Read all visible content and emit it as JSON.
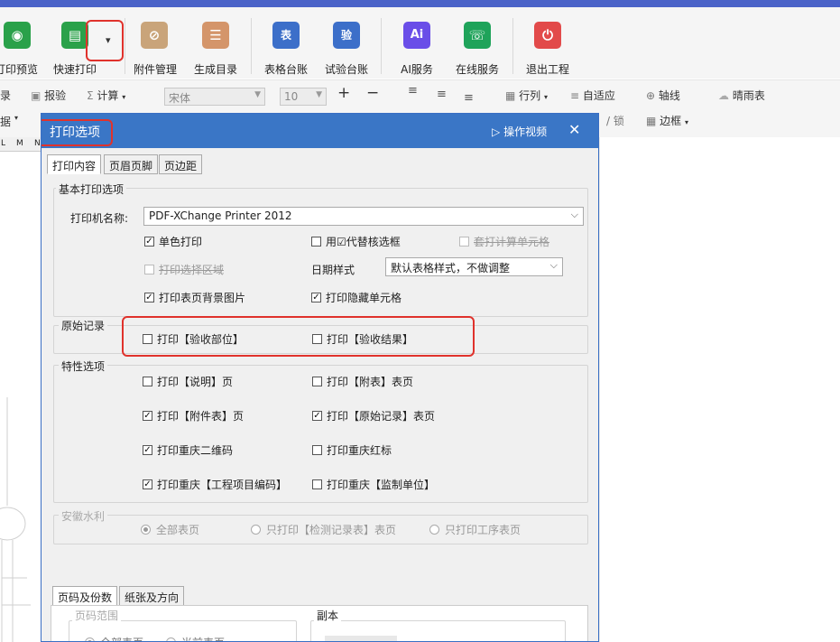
{
  "ribbon": {
    "items": [
      {
        "label": "打印预览",
        "icon": "eye-icon",
        "color": "#2aa14a",
        "glyph": "◉"
      },
      {
        "label": "快速打印",
        "icon": "printer-icon",
        "color": "#2aa14a",
        "glyph": "▤"
      },
      {
        "label": "附件管理",
        "icon": "paperclip-folder-icon",
        "color": "#c9a47a",
        "glyph": "⊘"
      },
      {
        "label": "生成目录",
        "icon": "list-icon",
        "color": "#d4956a",
        "glyph": "☰"
      },
      {
        "label": "表格台账",
        "icon": "table-ledger-icon",
        "color": "#3c6fc9",
        "glyph": "表"
      },
      {
        "label": "试验台账",
        "icon": "test-ledger-icon",
        "color": "#3c6fc9",
        "glyph": "验"
      },
      {
        "label": "AI服务",
        "icon": "ai-icon",
        "color": "#6a4ee8",
        "glyph": "Ai"
      },
      {
        "label": "在线服务",
        "icon": "headset-icon",
        "color": "#1fa35a",
        "glyph": "☏"
      },
      {
        "label": "退出工程",
        "icon": "power-icon",
        "color": "#e24a4a",
        "glyph": "⏻"
      }
    ],
    "dropdown_glyph": "▾"
  },
  "toolbar2": {
    "lu": "录",
    "ju": "据",
    "baoyan": "报验",
    "calc": "计算",
    "font": "宋体",
    "size": "10",
    "plus": "+",
    "minus": "−",
    "rowcol": "行列",
    "autofit": "自适应",
    "axis": "轴线",
    "weather": "晴雨表",
    "lock": "/ 锁",
    "border": "边框"
  },
  "sheet": {
    "cols": [
      "L",
      "M",
      "N"
    ]
  },
  "dialog": {
    "title": "打印选项",
    "video": "操作视频",
    "close": "✕",
    "tabs": [
      "打印内容",
      "页眉页脚",
      "页边距"
    ],
    "basic": {
      "title": "基本打印选项",
      "printer_label": "打印机名称:",
      "printer_value": "PDF-XChange Printer 2012",
      "mono": "单色打印",
      "replace_check": "用☑代替核选框",
      "no_calc": "套打计算单元格",
      "print_sel": "打印选择区域",
      "date_label": "日期样式",
      "date_value": "默认表格样式，不做调整",
      "bg_image": "打印表页背景图片",
      "hidden_cell": "打印隐藏单元格"
    },
    "original": {
      "title": "原始记录",
      "part": "打印【验收部位】",
      "result": "打印【验收结果】"
    },
    "special": {
      "title": "特性选项",
      "explain": "打印【说明】页",
      "appendix": "打印【附表】表页",
      "attach": "打印【附件表】页",
      "orig_rec": "打印【原始记录】表页",
      "cq_qr": "打印重庆二维码",
      "cq_red": "打印重庆红标",
      "cq_code": "打印重庆【工程项目编码】",
      "cq_sup": "打印重庆【监制单位】"
    },
    "anhui": {
      "title": "安徽水利",
      "all": "全部表页",
      "detect": "只打印【检测记录表】表页",
      "proc": "只打印工序表页"
    },
    "tabs2": [
      "页码及份数",
      "纸张及方向"
    ],
    "page_range": {
      "title": "页码范围",
      "all": "全部表页",
      "current": "当前表页"
    },
    "copies": {
      "title": "副本"
    }
  }
}
